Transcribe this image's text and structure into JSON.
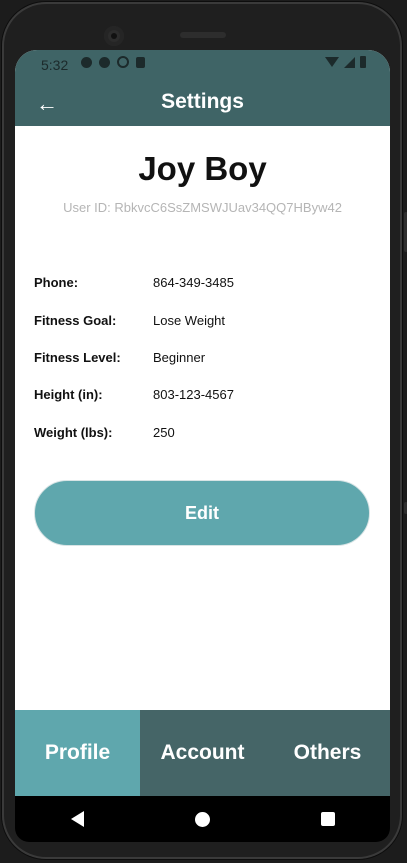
{
  "status_bar": {
    "time": "5:32",
    "icons_left": [
      "gear-icon",
      "shield-icon",
      "a-circle-icon",
      "sim-card-icon"
    ],
    "icons_right": [
      "wifi-icon",
      "signal-icon",
      "battery-icon"
    ]
  },
  "app_bar": {
    "back_icon": "←",
    "title": "Settings"
  },
  "profile": {
    "name": "Joy Boy",
    "user_id": "User ID: RbkvcC6SsZMSWJUav34QQ7HByw42"
  },
  "details": [
    {
      "label": "Phone:",
      "value": "864-349-3485"
    },
    {
      "label": "Fitness Goal:",
      "value": "Lose Weight"
    },
    {
      "label": "Fitness Level:",
      "value": "Beginner"
    },
    {
      "label": "Height (in):",
      "value": "803-123-4567"
    },
    {
      "label": "Weight (lbs):",
      "value": "250"
    }
  ],
  "edit_button": "Edit",
  "tabs": [
    {
      "label": "Profile",
      "active": true
    },
    {
      "label": "Account",
      "active": false
    },
    {
      "label": "Others",
      "active": false
    }
  ],
  "colors": {
    "app_bar": "#3f6466",
    "accent": "#5fa7ad",
    "tab_inactive": "#456567"
  }
}
